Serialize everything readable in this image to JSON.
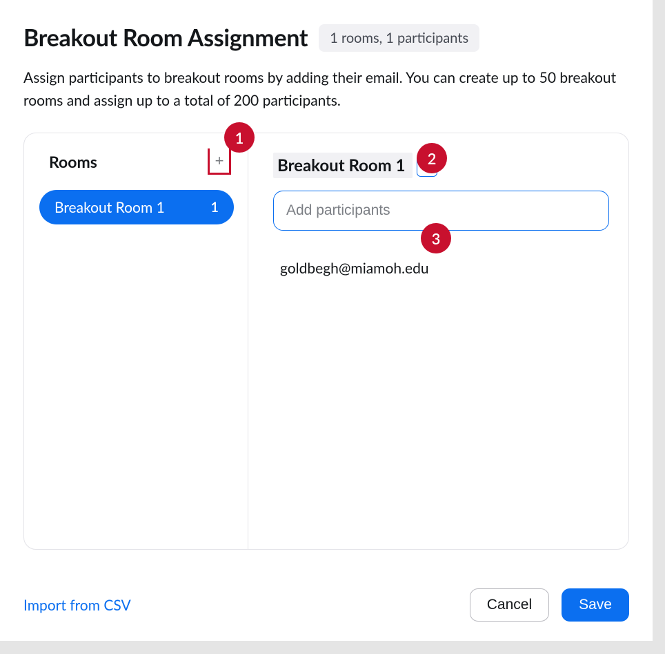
{
  "header": {
    "title": "Breakout Room Assignment",
    "summary": "1 rooms, 1 participants"
  },
  "description": "Assign participants to breakout rooms by adding their email. You can create up to 50 breakout rooms and assign up to a total of 200 participants.",
  "left": {
    "rooms_label": "Rooms",
    "add_button_glyph": "+",
    "rooms": [
      {
        "name": "Breakout Room 1",
        "count": "1"
      }
    ]
  },
  "right": {
    "selected_room_title": "Breakout Room 1",
    "participants_placeholder": "Add participants",
    "participants": [
      "goldbegh@miamoh.edu"
    ]
  },
  "callouts": {
    "c1": "1",
    "c2": "2",
    "c3": "3"
  },
  "footer": {
    "import_link": "Import from CSV",
    "cancel": "Cancel",
    "save": "Save"
  }
}
